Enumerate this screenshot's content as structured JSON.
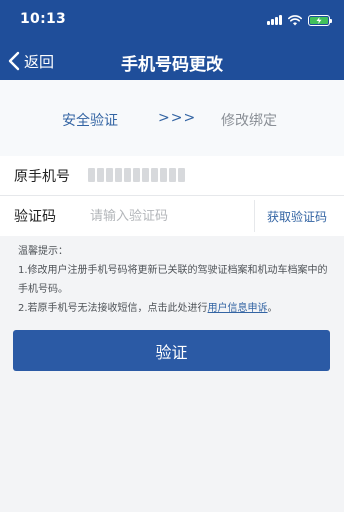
{
  "status_bar": {
    "time": "10:13"
  },
  "nav": {
    "back_label": "返回",
    "title": "手机号码更改"
  },
  "steps": {
    "step1": "安全验证",
    "separator": ">>>",
    "step2": "修改绑定"
  },
  "form": {
    "original_phone_label": "原手机号",
    "code_label": "验证码",
    "code_placeholder": "请输入验证码",
    "get_code_label": "获取验证码"
  },
  "tips": {
    "heading": "温馨提示：",
    "line1": "1.修改用户注册手机号码将更新已关联的驾驶证档案和机动车档案中的手机号码。",
    "line2_prefix": "2.若原手机号无法接收短信，点击此处进行",
    "line2_link": "用户信息申诉",
    "line2_suffix": "。"
  },
  "actions": {
    "verify_label": "验证"
  },
  "colors": {
    "brand": "#1f4e9a",
    "accent": "#3364a3",
    "button": "#2b5aa5",
    "battery": "#41c05b"
  }
}
